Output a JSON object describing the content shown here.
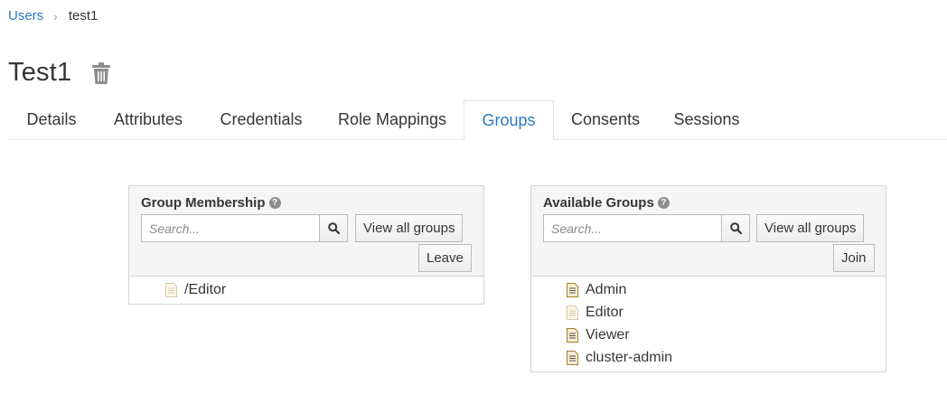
{
  "breadcrumb": {
    "parent": "Users",
    "separator": "›",
    "current": "test1"
  },
  "page": {
    "title": "Test1"
  },
  "tabs": [
    {
      "label": "Details"
    },
    {
      "label": "Attributes"
    },
    {
      "label": "Credentials"
    },
    {
      "label": "Role Mappings"
    },
    {
      "label": "Groups",
      "active": true
    },
    {
      "label": "Consents"
    },
    {
      "label": "Sessions"
    }
  ],
  "membership": {
    "title": "Group Membership",
    "search_placeholder": "Search...",
    "view_all_label": "View all groups",
    "action_label": "Leave",
    "items": [
      {
        "label": "/Editor",
        "icon": "document-icon-faded"
      }
    ]
  },
  "available": {
    "title": "Available Groups",
    "search_placeholder": "Search...",
    "view_all_label": "View all groups",
    "action_label": "Join",
    "items": [
      {
        "label": "Admin",
        "icon": "document-icon"
      },
      {
        "label": "Editor",
        "icon": "document-icon-faded"
      },
      {
        "label": "Viewer",
        "icon": "document-icon"
      },
      {
        "label": "cluster-admin",
        "icon": "document-icon"
      }
    ]
  },
  "colors": {
    "link": "#2b7bc0",
    "text": "#363636",
    "panel_header": "#f5f5f5",
    "border": "#d4d4d4"
  }
}
